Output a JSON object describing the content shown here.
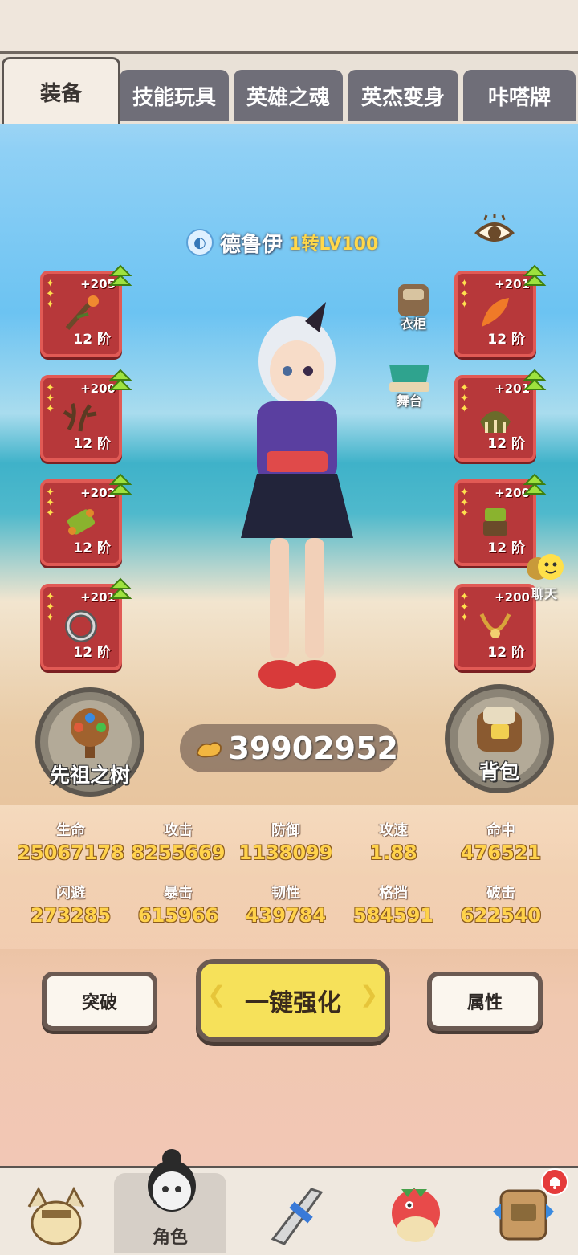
{
  "tabs": [
    {
      "label": "装备",
      "active": true
    },
    {
      "label": "技能玩具",
      "active": false
    },
    {
      "label": "英雄之魂",
      "active": false
    },
    {
      "label": "英杰变身",
      "active": false
    },
    {
      "label": "咔嗒牌",
      "active": false
    }
  ],
  "character": {
    "name": "德鲁伊",
    "level": "1转LV100"
  },
  "left_slots": [
    {
      "plus": "+205",
      "tier": "12 阶",
      "item_icon": "staff-icon"
    },
    {
      "plus": "+200",
      "tier": "12 阶",
      "item_icon": "antler-icon"
    },
    {
      "plus": "+202",
      "tier": "12 阶",
      "item_icon": "bracelet-icon"
    },
    {
      "plus": "+201",
      "tier": "12 阶",
      "item_icon": "ring-icon"
    }
  ],
  "right_slots": [
    {
      "plus": "+201",
      "tier": "12 阶",
      "item_icon": "feather-icon"
    },
    {
      "plus": "+201",
      "tier": "12 阶",
      "item_icon": "hat-icon"
    },
    {
      "plus": "+200",
      "tier": "12 阶",
      "item_icon": "armor-icon"
    },
    {
      "plus": "+200",
      "tier": "12 阶",
      "item_icon": "necklace-icon"
    }
  ],
  "side_buttons": {
    "wardrobe": "衣柜",
    "stage": "舞台",
    "chat": "聊天"
  },
  "round_buttons": {
    "ancestor_tree": "先祖之树",
    "backpack": "背包"
  },
  "combat_power": "39902952",
  "stats": [
    {
      "label": "生命",
      "value": "25067178"
    },
    {
      "label": "攻击",
      "value": "8255669"
    },
    {
      "label": "防御",
      "value": "1138099"
    },
    {
      "label": "攻速",
      "value": "1.88"
    },
    {
      "label": "命中",
      "value": "476521"
    },
    {
      "label": "闪避",
      "value": "273285"
    },
    {
      "label": "暴击",
      "value": "615966"
    },
    {
      "label": "韧性",
      "value": "439784"
    },
    {
      "label": "格挡",
      "value": "584591"
    },
    {
      "label": "破击",
      "value": "622540"
    }
  ],
  "actions": {
    "breakthrough": "突破",
    "one_click_enhance": "一键强化",
    "attributes": "属性"
  },
  "nav": [
    {
      "label": "",
      "icon": "beast-icon"
    },
    {
      "label": "角色",
      "icon": "character-icon",
      "active": true
    },
    {
      "label": "",
      "icon": "sword-icon"
    },
    {
      "label": "",
      "icon": "dino-icon"
    },
    {
      "label": "",
      "icon": "totem-icon",
      "badge": true
    }
  ],
  "colors": {
    "slot_red": "#b7383a",
    "stat_gold": "#ffd24b",
    "button_yellow": "#f6e15a"
  }
}
